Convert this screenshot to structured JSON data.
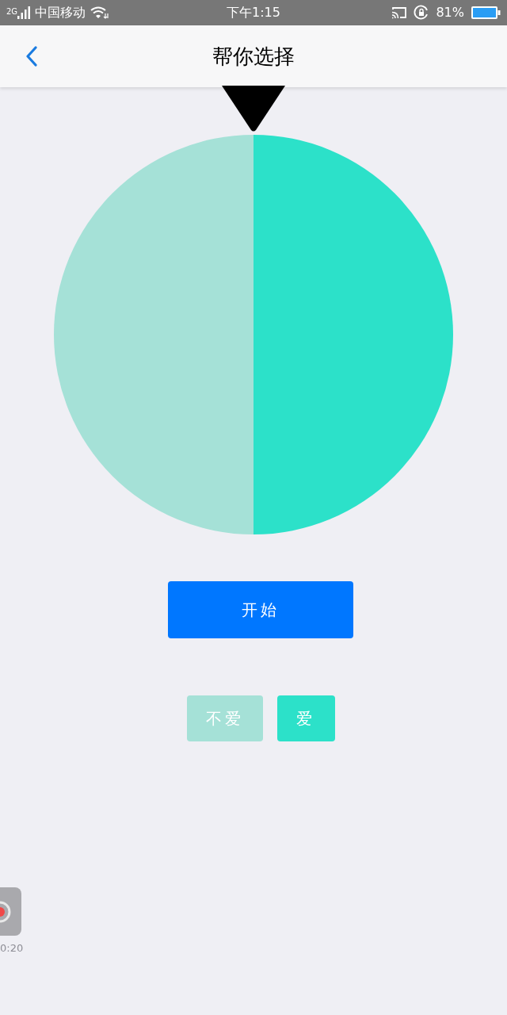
{
  "status_bar": {
    "network": "2G",
    "carrier": "中国移动",
    "time": "下午1:15",
    "battery": "81%"
  },
  "header": {
    "title": "帮你选择"
  },
  "options": [
    {
      "label": "不爱",
      "color": "#a5e1d7"
    },
    {
      "label": "爱",
      "color": "#2ce1c9"
    }
  ],
  "start_button": {
    "label": "开始"
  },
  "recorder": {
    "timer": "0:20"
  }
}
